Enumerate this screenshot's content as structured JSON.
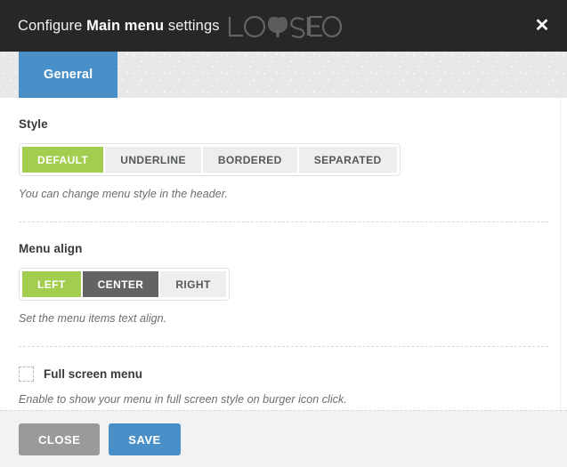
{
  "header": {
    "title_prefix": "Configure ",
    "title_strong": "Main menu",
    "title_suffix": " settings",
    "watermark_text": "LOYSEO",
    "close_icon": "close-icon",
    "background_color": "#272727"
  },
  "tabs": [
    {
      "label": "General",
      "active": true,
      "color": "#4a90c8"
    }
  ],
  "fields": [
    {
      "key": "style",
      "label": "Style",
      "description": "You can change menu style in the header.",
      "options": [
        {
          "label": "DEFAULT",
          "state": "active"
        },
        {
          "label": "UNDERLINE",
          "state": "normal"
        },
        {
          "label": "BORDERED",
          "state": "normal"
        },
        {
          "label": "SEPARATED",
          "state": "normal"
        }
      ]
    },
    {
      "key": "menu_align",
      "label": "Menu align",
      "description": "Set the menu items text align.",
      "options": [
        {
          "label": "LEFT",
          "state": "active"
        },
        {
          "label": "CENTER",
          "state": "hover"
        },
        {
          "label": "RIGHT",
          "state": "normal"
        }
      ]
    },
    {
      "key": "full_screen_menu",
      "label": "Full screen menu",
      "description": "Enable to show your menu in full screen style on burger icon click.",
      "checked": false
    }
  ],
  "footer": {
    "close_label": "CLOSE",
    "save_label": "SAVE"
  },
  "colors": {
    "accent_green": "#a3cd4e",
    "accent_blue": "#4a90c8",
    "neutral_gray": "#9a9a9a",
    "hover_gray": "#636363"
  }
}
